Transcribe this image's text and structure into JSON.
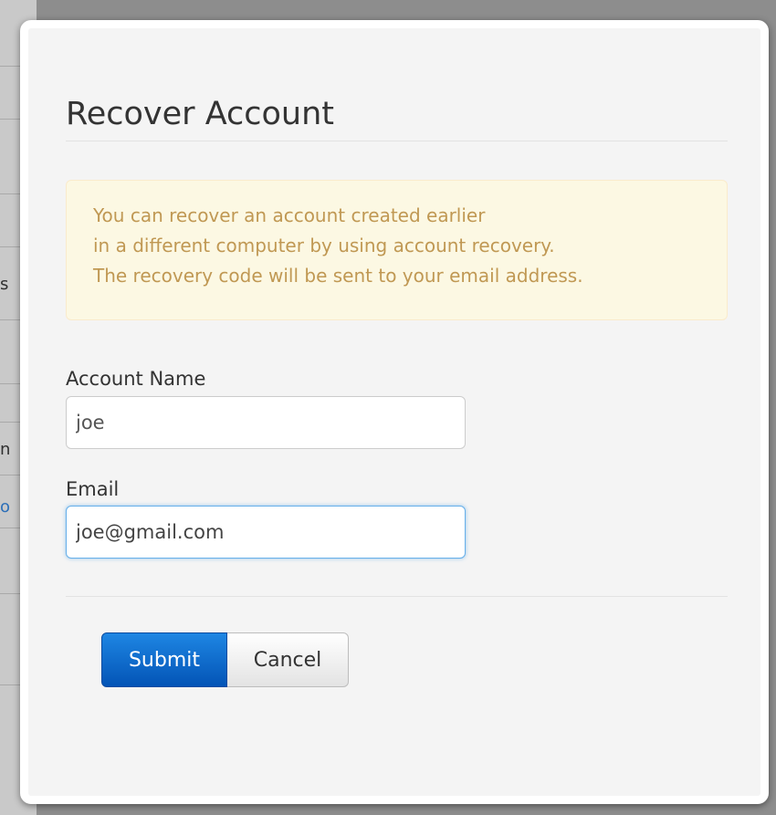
{
  "dialog": {
    "title": "Recover Account",
    "info_lines": [
      "You can recover an account created earlier",
      "in a different computer by using account recovery.",
      "The recovery code will be sent to your email address."
    ],
    "account_name": {
      "label": "Account Name",
      "value": "joe"
    },
    "email": {
      "label": "Email",
      "value": "joe@gmail.com"
    },
    "buttons": {
      "submit": "Submit",
      "cancel": "Cancel"
    }
  },
  "background": {
    "partial_chars": [
      "s",
      "n",
      "o"
    ]
  },
  "colors": {
    "accent": "#0866c6",
    "alert_background": "#fcf8e3",
    "alert_text": "#c09853",
    "focus_border": "#66afe9"
  }
}
